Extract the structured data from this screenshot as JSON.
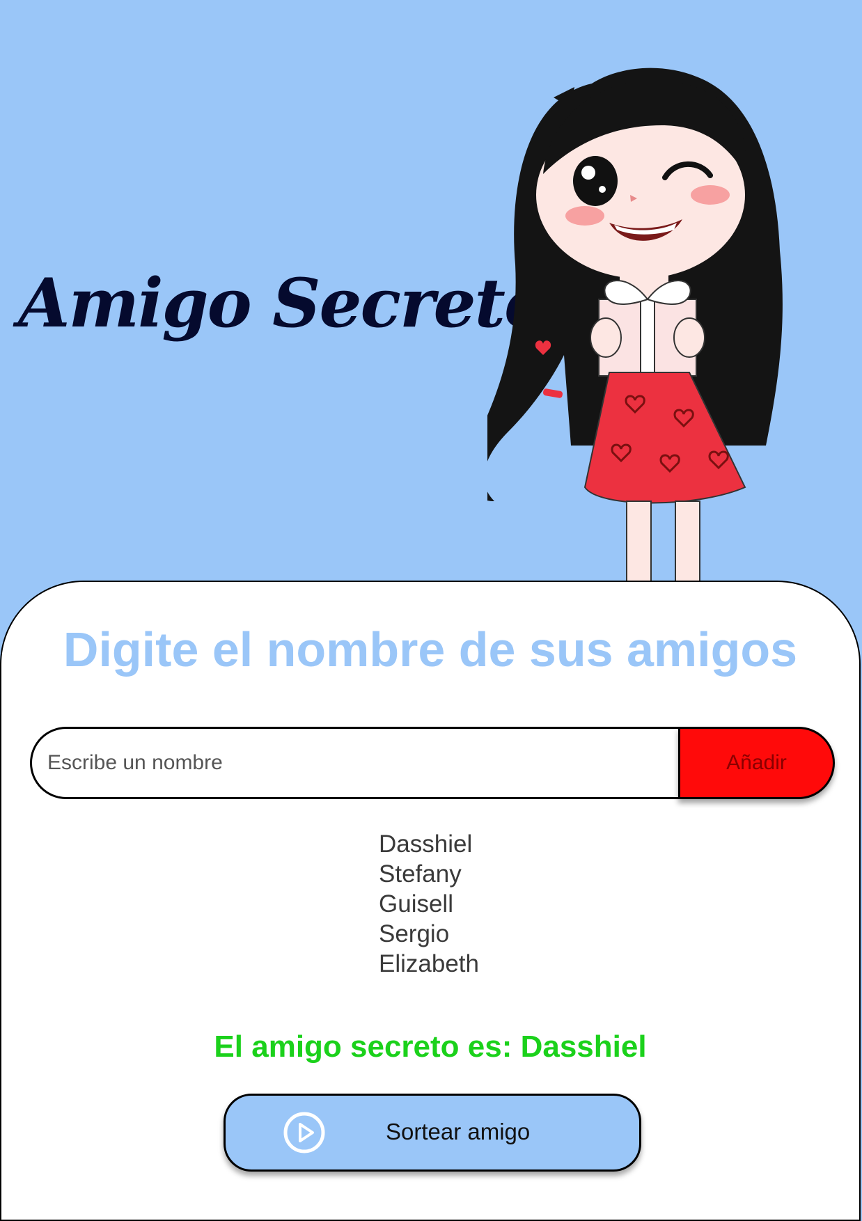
{
  "header": {
    "title": "Amigo Secreto",
    "illustration": "girl-with-gift-illustration"
  },
  "main": {
    "section_title": "Digite el nombre de sus amigos",
    "input": {
      "placeholder": "Escribe un nombre",
      "value": ""
    },
    "add_button_label": "Añadir",
    "friends": [
      "Dasshiel",
      "Stefany",
      "Guisell",
      "Sergio",
      "Elizabeth"
    ],
    "result_text": "El amigo secreto es: Dasshiel",
    "draw_button": {
      "label": "Sortear amigo",
      "icon": "play-circle-icon"
    }
  },
  "colors": {
    "background": "#9ac6f8",
    "title": "#050a2e",
    "section_title": "#9ac6f8",
    "add_button": "#ff0a0a",
    "result": "#1bd11b",
    "draw_button": "#9ac6f8"
  }
}
